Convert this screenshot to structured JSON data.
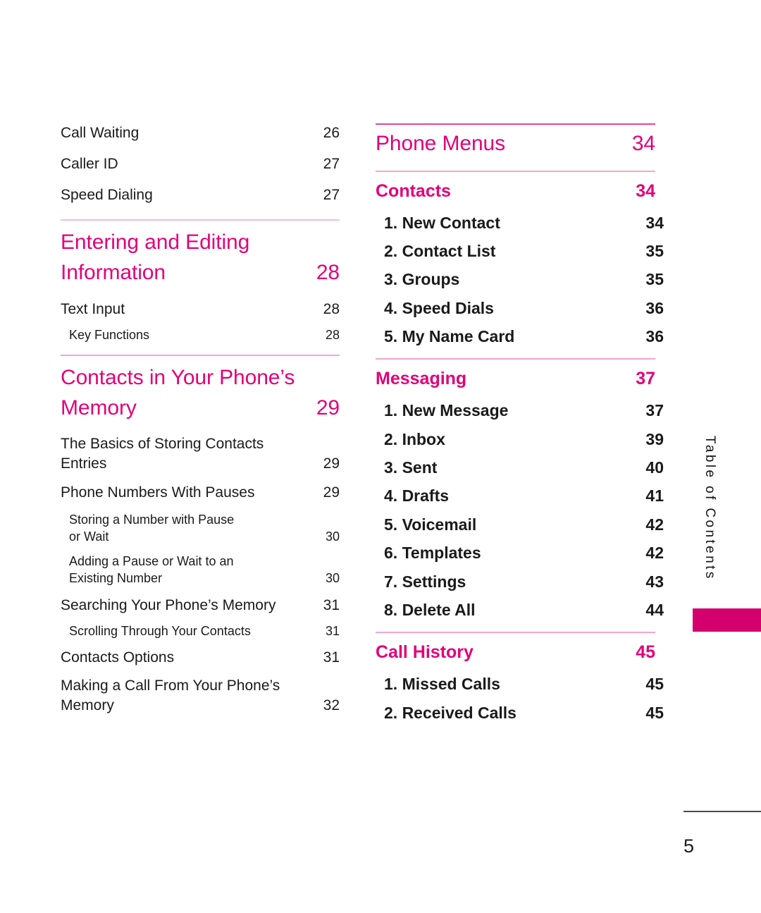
{
  "page": {
    "folio": "5",
    "side_tab_label": "Table of Contents",
    "accent_color": "#E1007A",
    "tab_color": "#D4006E"
  },
  "left_column": {
    "top_entries": [
      {
        "label": "Call Waiting",
        "page": "26"
      },
      {
        "label": "Caller ID",
        "page": "27"
      },
      {
        "label": "Speed Dialing",
        "page": "27"
      }
    ],
    "chapter_1": {
      "title_line1": "Entering and Editing",
      "title_line2": "Information",
      "page": "28"
    },
    "chapter_1_entries": [
      {
        "label": "Text Input",
        "page": "28"
      },
      {
        "label": "Key Functions",
        "page": "28"
      }
    ],
    "chapter_2": {
      "title_line1": "Contacts in Your Phone’s",
      "title_line2": "Memory",
      "page": "29"
    },
    "chapter_2_entries": [
      {
        "line1": "The Basics of Storing Contacts",
        "line2": "Entries",
        "page": "29"
      },
      {
        "label": "Phone Numbers With Pauses",
        "page": "29"
      },
      {
        "line1": "Storing a Number with Pause",
        "line2": "or Wait",
        "page": "30"
      },
      {
        "line1": "Adding a Pause or Wait to an",
        "line2": "Existing Number",
        "page": "30"
      },
      {
        "label": "Searching Your Phone’s Memory",
        "page": "31"
      },
      {
        "label": "Scrolling Through Your Contacts",
        "page": "31"
      },
      {
        "label": "Contacts Options",
        "page": "31"
      },
      {
        "line1": "Making a Call From Your Phone’s",
        "line2": "Memory",
        "page": "32"
      }
    ]
  },
  "right_column": {
    "chapter": {
      "title": "Phone Menus",
      "page": "34"
    },
    "sections": [
      {
        "heading": "Contacts",
        "heading_page": "34",
        "items": [
          {
            "label": "1. New Contact",
            "page": "34"
          },
          {
            "label": "2. Contact List",
            "page": "35"
          },
          {
            "label": "3. Groups",
            "page": "35"
          },
          {
            "label": "4. Speed Dials",
            "page": "36"
          },
          {
            "label": "5. My Name Card",
            "page": "36"
          }
        ]
      },
      {
        "heading": "Messaging",
        "heading_page": "37",
        "items": [
          {
            "label": "1. New Message",
            "page": "37"
          },
          {
            "label": "2. Inbox",
            "page": "39"
          },
          {
            "label": "3. Sent",
            "page": "40"
          },
          {
            "label": "4. Drafts",
            "page": "41"
          },
          {
            "label": "5. Voicemail",
            "page": "42"
          },
          {
            "label": "6. Templates",
            "page": "42"
          },
          {
            "label": "7. Settings",
            "page": "43"
          },
          {
            "label": "8. Delete All",
            "page": "44"
          }
        ]
      },
      {
        "heading": "Call History",
        "heading_page": "45",
        "items": [
          {
            "label": "1. Missed Calls",
            "page": "45"
          },
          {
            "label": "2. Received Calls",
            "page": "45"
          }
        ]
      }
    ]
  }
}
